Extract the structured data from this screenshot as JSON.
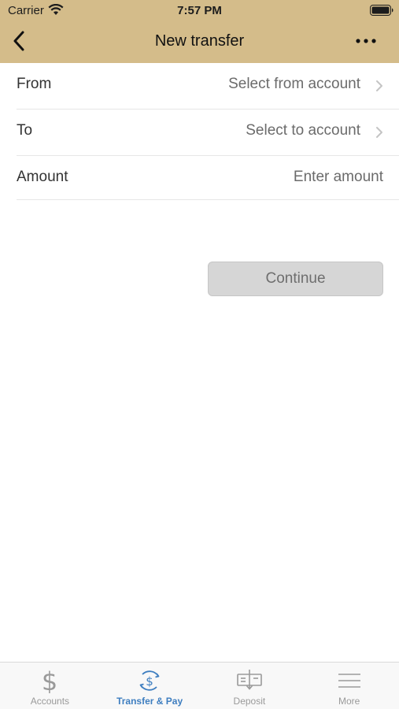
{
  "status_bar": {
    "carrier": "Carrier",
    "time": "7:57 PM"
  },
  "nav": {
    "title": "New transfer",
    "back_icon": "chevron-left-icon",
    "more_icon": "ellipsis-icon"
  },
  "form": {
    "from": {
      "label": "From",
      "placeholder": "Select from account"
    },
    "to": {
      "label": "To",
      "placeholder": "Select to account"
    },
    "amount": {
      "label": "Amount",
      "placeholder": "Enter amount"
    }
  },
  "continue_label": "Continue",
  "tabs": [
    {
      "label": "Accounts",
      "icon": "dollar-icon",
      "active": false
    },
    {
      "label": "Transfer & Pay",
      "icon": "transfer-dollar-icon",
      "active": true
    },
    {
      "label": "Deposit",
      "icon": "check-deposit-icon",
      "active": false
    },
    {
      "label": "More",
      "icon": "hamburger-icon",
      "active": false
    }
  ],
  "colors": {
    "header_bg": "#d4bc8a",
    "active_tab": "#3e7ec0",
    "inactive_tab": "#9a9a9a",
    "button_bg": "#d6d6d6"
  }
}
